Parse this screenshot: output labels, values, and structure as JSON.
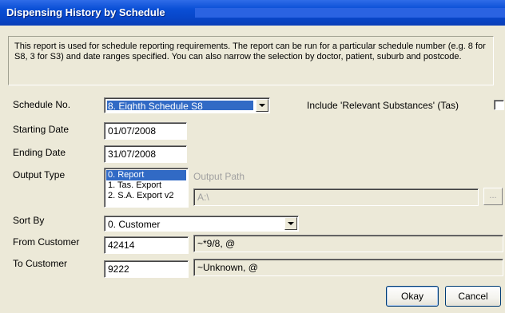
{
  "window": {
    "title": "Dispensing History by Schedule"
  },
  "description": "This report is used for schedule reporting requirements.  The report can be run for a particular schedule number (e.g. 8 for S8, 3 for S3) and date ranges specified. You can also narrow the selection by doctor, patient, suburb and postcode.",
  "schedule": {
    "label": "Schedule No.",
    "value": "8. Eighth  Schedule S8"
  },
  "relevant_substances": {
    "label": "Include 'Relevant Substances' (Tas)",
    "checked": false
  },
  "starting_date": {
    "label": "Starting Date",
    "value": "01/07/2008"
  },
  "ending_date": {
    "label": "Ending Date",
    "value": "31/07/2008"
  },
  "output_type": {
    "label": "Output Type",
    "options": [
      "0. Report",
      "1. Tas. Export",
      "2. S.A. Export v2"
    ],
    "selected_index": 0
  },
  "output_path": {
    "label": "Output Path",
    "value": "A:\\",
    "browse_label": "..."
  },
  "sort_by": {
    "label": "Sort By",
    "value": "0. Customer"
  },
  "from_customer": {
    "label": "From Customer",
    "code": "42414",
    "name": "~*9/8, @"
  },
  "to_customer": {
    "label": "To Customer",
    "code": "9222",
    "name": "~Unknown, @"
  },
  "buttons": {
    "okay": "Okay",
    "cancel": "Cancel"
  }
}
